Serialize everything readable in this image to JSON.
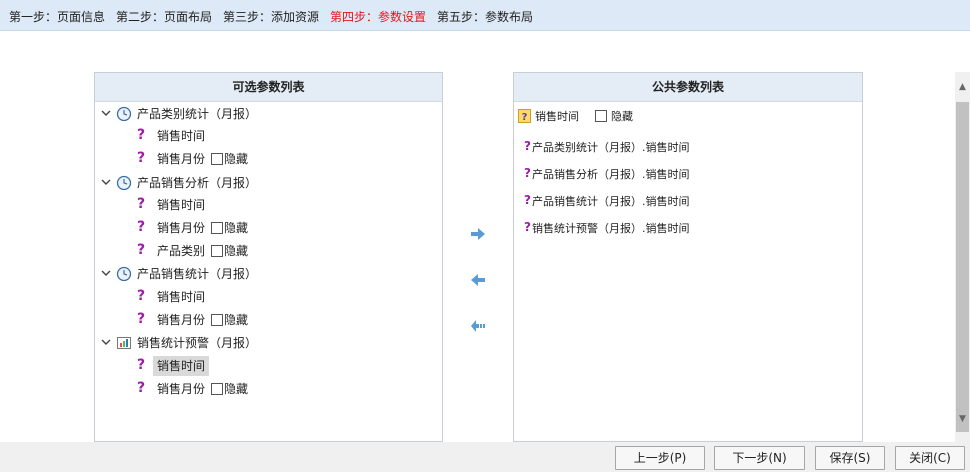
{
  "steps": [
    {
      "label": "第一步：页面信息",
      "active": false
    },
    {
      "label": "第二步：页面布局",
      "active": false
    },
    {
      "label": "第三步：添加资源",
      "active": false
    },
    {
      "label": "第四步：参数设置",
      "active": true
    },
    {
      "label": "第五步：参数布局",
      "active": false
    }
  ],
  "left_panel": {
    "title": "可选参数列表",
    "tree": [
      {
        "label": "产品类别统计（月报）",
        "icon": "clock-icon",
        "children": [
          {
            "label": "销售时间",
            "hide_label": ""
          },
          {
            "label": "销售月份",
            "hide_label": "隐藏"
          }
        ]
      },
      {
        "label": "产品销售分析（月报）",
        "icon": "clock-icon",
        "children": [
          {
            "label": "销售时间",
            "hide_label": ""
          },
          {
            "label": "销售月份",
            "hide_label": "隐藏"
          },
          {
            "label": "产品类别",
            "hide_label": "隐藏"
          }
        ]
      },
      {
        "label": "产品销售统计（月报）",
        "icon": "clock-icon",
        "children": [
          {
            "label": "销售时间",
            "hide_label": ""
          },
          {
            "label": "销售月份",
            "hide_label": "隐藏"
          }
        ]
      },
      {
        "label": "销售统计预警（月报）",
        "icon": "chart-icon",
        "children": [
          {
            "label": "销售时间",
            "hide_label": "",
            "selected": true
          },
          {
            "label": "销售月份",
            "hide_label": "隐藏"
          }
        ]
      }
    ]
  },
  "right_panel": {
    "title": "公共参数列表",
    "param": {
      "label": "销售时间",
      "hide_label": "隐藏"
    },
    "items": [
      "产品类别统计（月报）.销售时间",
      "产品销售分析（月报）.销售时间",
      "产品销售统计（月报）.销售时间",
      "销售统计预警（月报）.销售时间"
    ]
  },
  "buttons": {
    "prev": "上一步(P)",
    "next": "下一步(N)",
    "save": "保存(S)",
    "close": "关闭(C)"
  },
  "colors": {
    "active_step": "#e8141c",
    "question_mark": "#9b1fa6",
    "arrow": "#5b9bd5"
  }
}
